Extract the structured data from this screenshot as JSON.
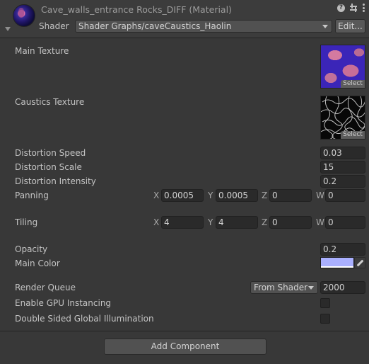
{
  "header": {
    "title": "Cave_walls_entrance Rocks_DIFF (Material)",
    "shader_label": "Shader",
    "shader_value": "Shader Graphs/caveCaustics_Haolin",
    "edit_button": "Edit...",
    "help_icon_glyph": "?"
  },
  "textures": {
    "main_label": "Main Texture",
    "caustics_label": "Caustics Texture",
    "select_label": "Select"
  },
  "properties": {
    "distortion_speed": {
      "label": "Distortion Speed",
      "value": "0.03"
    },
    "distortion_scale": {
      "label": "Distortion Scale",
      "value": "15"
    },
    "distortion_intensity": {
      "label": "Distortion Intensity",
      "value": "0.2"
    },
    "panning": {
      "label": "Panning",
      "x": "0.0005",
      "y": "0.0005",
      "z": "0",
      "w": "0"
    },
    "tiling": {
      "label": "Tiling",
      "x": "4",
      "y": "4",
      "z": "0",
      "w": "0"
    },
    "opacity": {
      "label": "Opacity",
      "value": "0.2"
    },
    "main_color": {
      "label": "Main Color",
      "color": "#aab0ff"
    }
  },
  "axis_labels": {
    "x": "X",
    "y": "Y",
    "z": "Z",
    "w": "W"
  },
  "advanced": {
    "render_queue": {
      "label": "Render Queue",
      "mode": "From Shader",
      "value": "2000"
    },
    "gpu_instancing": {
      "label": "Enable GPU Instancing",
      "checked": false
    },
    "double_sided_gi": {
      "label": "Double Sided Global Illumination",
      "checked": false
    }
  },
  "footer": {
    "add_component": "Add Component"
  },
  "colors": {
    "background": "#383838",
    "header": "#3c3c3c",
    "field": "#2a2a2a",
    "main_color_swatch": "#aab0ff"
  }
}
